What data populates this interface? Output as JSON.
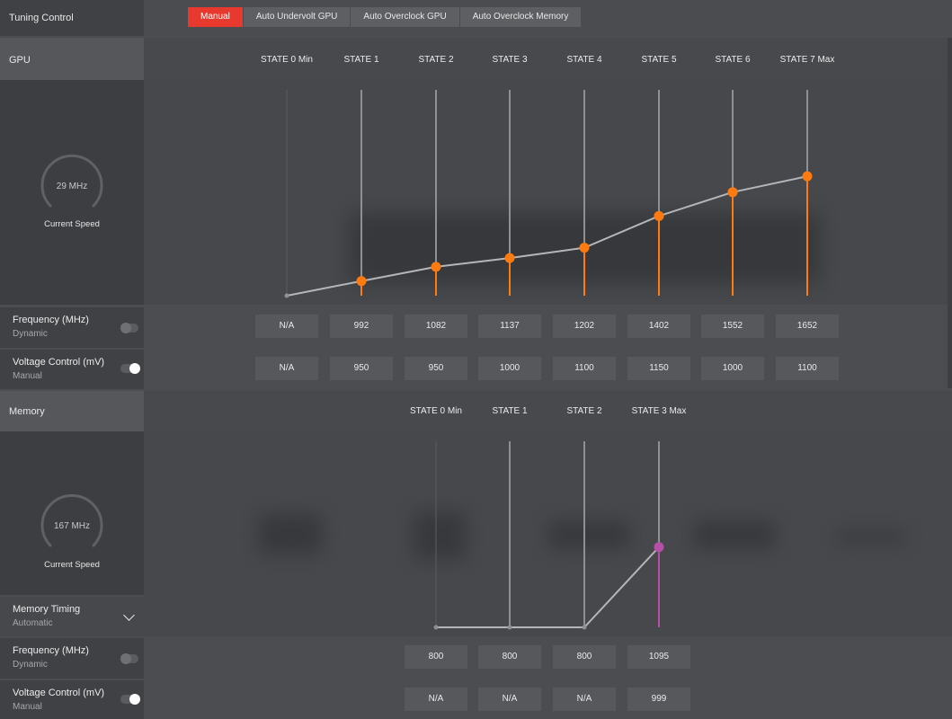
{
  "tuning": {
    "label": "Tuning Control",
    "tabs": [
      {
        "label": "Manual",
        "active": true
      },
      {
        "label": "Auto Undervolt GPU",
        "active": false
      },
      {
        "label": "Auto Overclock GPU",
        "active": false
      },
      {
        "label": "Auto Overclock Memory",
        "active": false
      }
    ]
  },
  "gpu": {
    "label": "GPU",
    "gauge": {
      "value": "29 MHz",
      "caption": "Current Speed"
    },
    "states": [
      "STATE 0 Min",
      "STATE 1",
      "STATE 2",
      "STATE 3",
      "STATE 4",
      "STATE 5",
      "STATE 6",
      "STATE 7 Max"
    ],
    "frequency_row": {
      "title": "Frequency (MHz)",
      "mode": "Dynamic",
      "toggle_on": false,
      "values": [
        "N/A",
        "992",
        "1082",
        "1137",
        "1202",
        "1402",
        "1552",
        "1652"
      ]
    },
    "voltage_row": {
      "title": "Voltage Control (mV)",
      "mode": "Manual",
      "toggle_on": true,
      "values": [
        "N/A",
        "950",
        "950",
        "1000",
        "1100",
        "1150",
        "1000",
        "1100"
      ]
    },
    "curve_color": "#ff7b0f"
  },
  "memory": {
    "label": "Memory",
    "gauge": {
      "value": "167 MHz",
      "caption": "Current Speed"
    },
    "states": [
      "STATE 0 Min",
      "STATE 1",
      "STATE 2",
      "STATE 3 Max"
    ],
    "timing_row": {
      "title": "Memory Timing",
      "mode": "Automatic"
    },
    "frequency_row": {
      "title": "Frequency (MHz)",
      "mode": "Dynamic",
      "toggle_on": false,
      "values": [
        "800",
        "800",
        "800",
        "1095"
      ]
    },
    "voltage_row": {
      "title": "Voltage Control (mV)",
      "mode": "Manual",
      "toggle_on": true,
      "values": [
        "N/A",
        "N/A",
        "N/A",
        "999"
      ]
    },
    "curve_color": "#b54fa8"
  }
}
